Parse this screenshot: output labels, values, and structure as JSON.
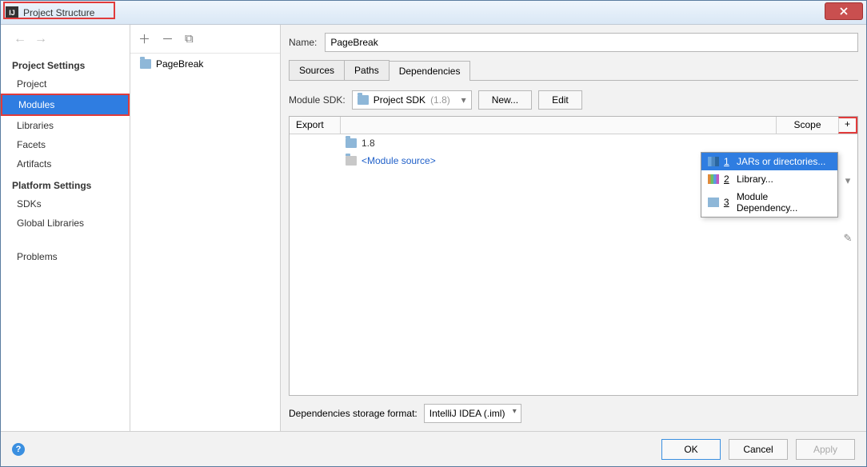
{
  "window": {
    "title": "Project Structure"
  },
  "nav": {
    "project_settings_h": "Project Settings",
    "items1": [
      "Project",
      "Modules",
      "Libraries",
      "Facets",
      "Artifacts"
    ],
    "platform_settings_h": "Platform Settings",
    "items2": [
      "SDKs",
      "Global Libraries"
    ],
    "problems": "Problems",
    "selected": "Modules"
  },
  "modules": {
    "list": [
      "PageBreak"
    ]
  },
  "editor": {
    "name_label": "Name:",
    "name_value": "PageBreak",
    "tabs": [
      "Sources",
      "Paths",
      "Dependencies"
    ],
    "active_tab": "Dependencies",
    "sdk_label": "Module SDK:",
    "sdk_value": "Project SDK",
    "sdk_hint": "(1.8)",
    "new_btn": "New...",
    "edit_btn": "Edit",
    "cols": {
      "export": "Export",
      "scope": "Scope",
      "add": "+"
    },
    "deps": [
      {
        "icon": "folder",
        "label": "1.8",
        "cls": "txt"
      },
      {
        "icon": "folder",
        "label": "<Module source>",
        "cls": "module-src"
      }
    ],
    "popup": [
      {
        "n": "1",
        "label": "JARs or directories...",
        "ico": "ico-jar",
        "sel": true
      },
      {
        "n": "2",
        "label": "Library...",
        "ico": "ico-lib",
        "sel": false
      },
      {
        "n": "3",
        "label": "Module Dependency...",
        "ico": "ico-mod",
        "sel": false
      }
    ],
    "storage_label": "Dependencies storage format:",
    "storage_value": "IntelliJ IDEA (.iml)"
  },
  "footer": {
    "ok": "OK",
    "cancel": "Cancel",
    "apply": "Apply"
  }
}
